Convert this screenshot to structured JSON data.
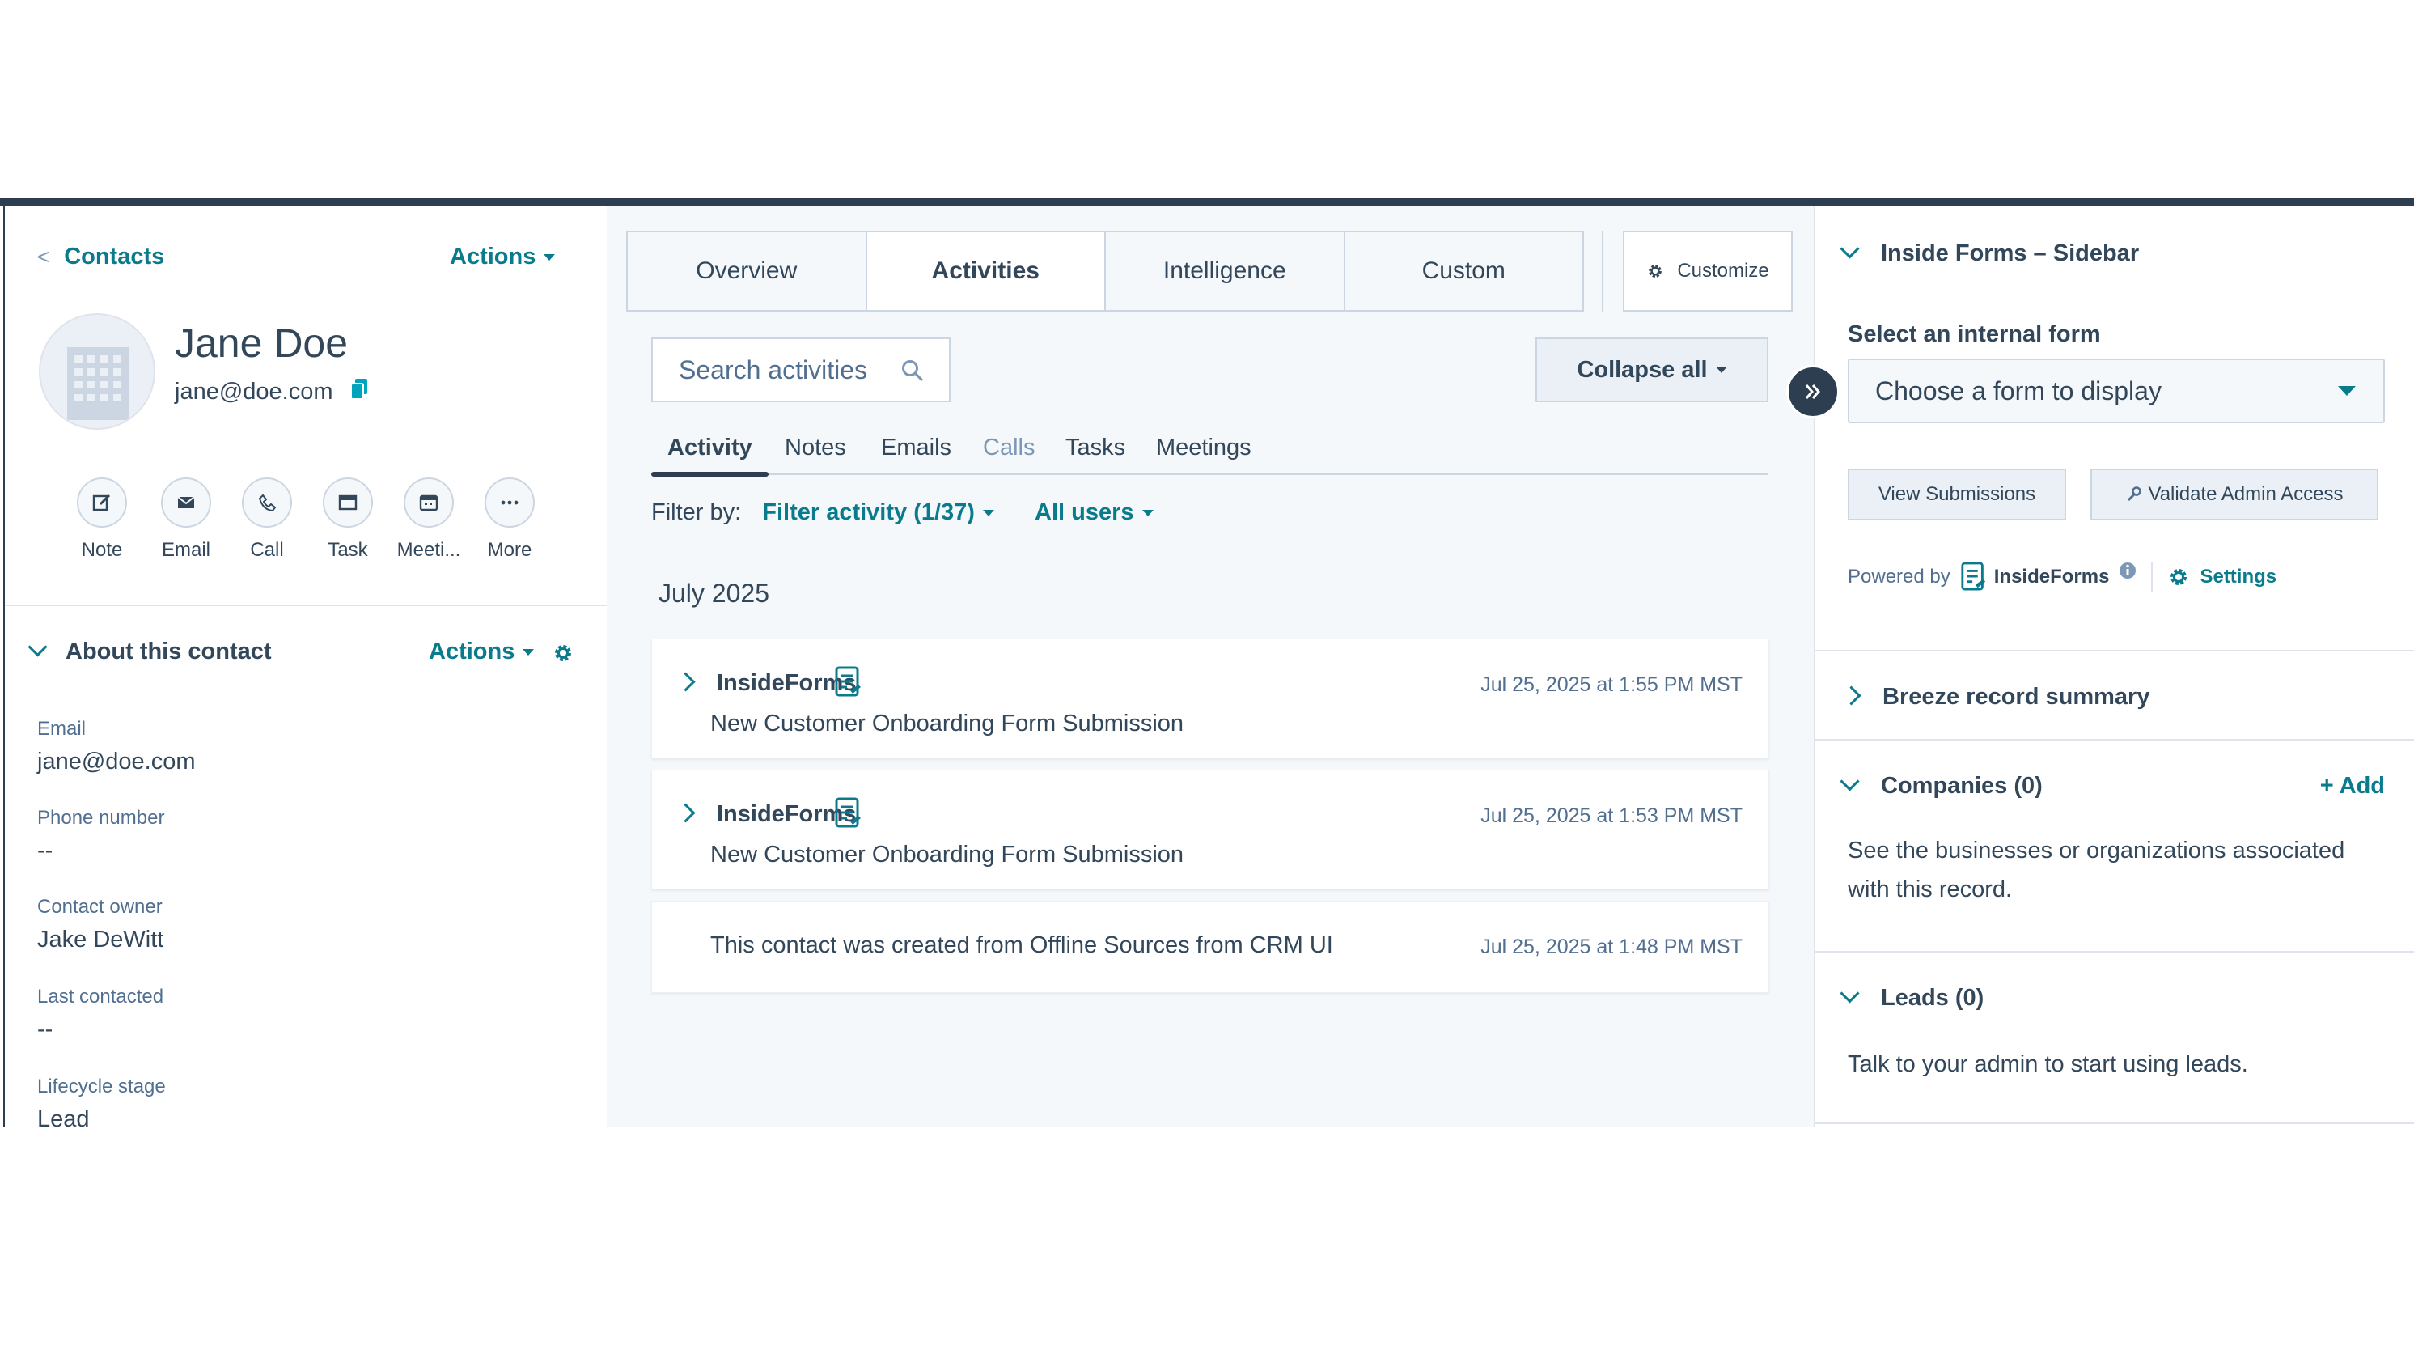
{
  "left": {
    "back_label": "Contacts",
    "actions_label": "Actions",
    "contact_name": "Jane Doe",
    "contact_email": "jane@doe.com",
    "quick_actions": [
      {
        "label": "Note",
        "icon": "note-icon"
      },
      {
        "label": "Email",
        "icon": "email-icon"
      },
      {
        "label": "Call",
        "icon": "call-icon"
      },
      {
        "label": "Task",
        "icon": "task-icon"
      },
      {
        "label": "Meeti...",
        "icon": "meeting-icon"
      },
      {
        "label": "More",
        "icon": "more-icon"
      }
    ],
    "about": {
      "title": "About this contact",
      "actions_label": "Actions",
      "properties": [
        {
          "label": "Email",
          "value": "jane@doe.com"
        },
        {
          "label": "Phone number",
          "value": "--"
        },
        {
          "label": "Contact owner",
          "value": "Jake DeWitt"
        },
        {
          "label": "Last contacted",
          "value": "--"
        },
        {
          "label": "Lifecycle stage",
          "value": "Lead"
        }
      ]
    }
  },
  "center": {
    "tabs": [
      "Overview",
      "Activities",
      "Intelligence",
      "Custom"
    ],
    "active_tab": "Activities",
    "customize_label": "Customize",
    "search_placeholder": "Search activities",
    "collapse_label": "Collapse all",
    "subtabs": [
      "Activity",
      "Notes",
      "Emails",
      "Calls",
      "Tasks",
      "Meetings"
    ],
    "filter": {
      "label": "Filter by:",
      "activity_filter": "Filter activity (1/37)",
      "users_filter": "All users"
    },
    "month": "July 2025",
    "activities": [
      {
        "app": "InsideForms",
        "title": "New Customer Onboarding Form Submission",
        "time": "Jul 25, 2025 at 1:55 PM MST"
      },
      {
        "app": "InsideForms",
        "title": "New Customer Onboarding Form Submission",
        "time": "Jul 25, 2025 at 1:53 PM MST"
      },
      {
        "title": "This contact was created from Offline Sources from CRM UI",
        "time": "Jul 25, 2025 at 1:48 PM MST"
      }
    ]
  },
  "right": {
    "sidebar_title": "Inside Forms – Sidebar",
    "select_label": "Select an internal form",
    "select_placeholder": "Choose a form to display",
    "view_submissions": "View Submissions",
    "validate_admin": "Validate Admin Access",
    "powered_by": "Powered by",
    "brand": "InsideForms",
    "settings": "Settings",
    "breeze_title": "Breeze record summary",
    "companies_title": "Companies (0)",
    "add_label": "+ Add",
    "companies_body": "See the businesses or organizations associated with this record.",
    "leads_title": "Leads (0)",
    "leads_body": "Talk to your admin to start using leads."
  },
  "colors": {
    "accent": "#0a7b8c",
    "text": "#33475b",
    "header_bar": "#2d3e50",
    "border": "#cbd6e2"
  }
}
